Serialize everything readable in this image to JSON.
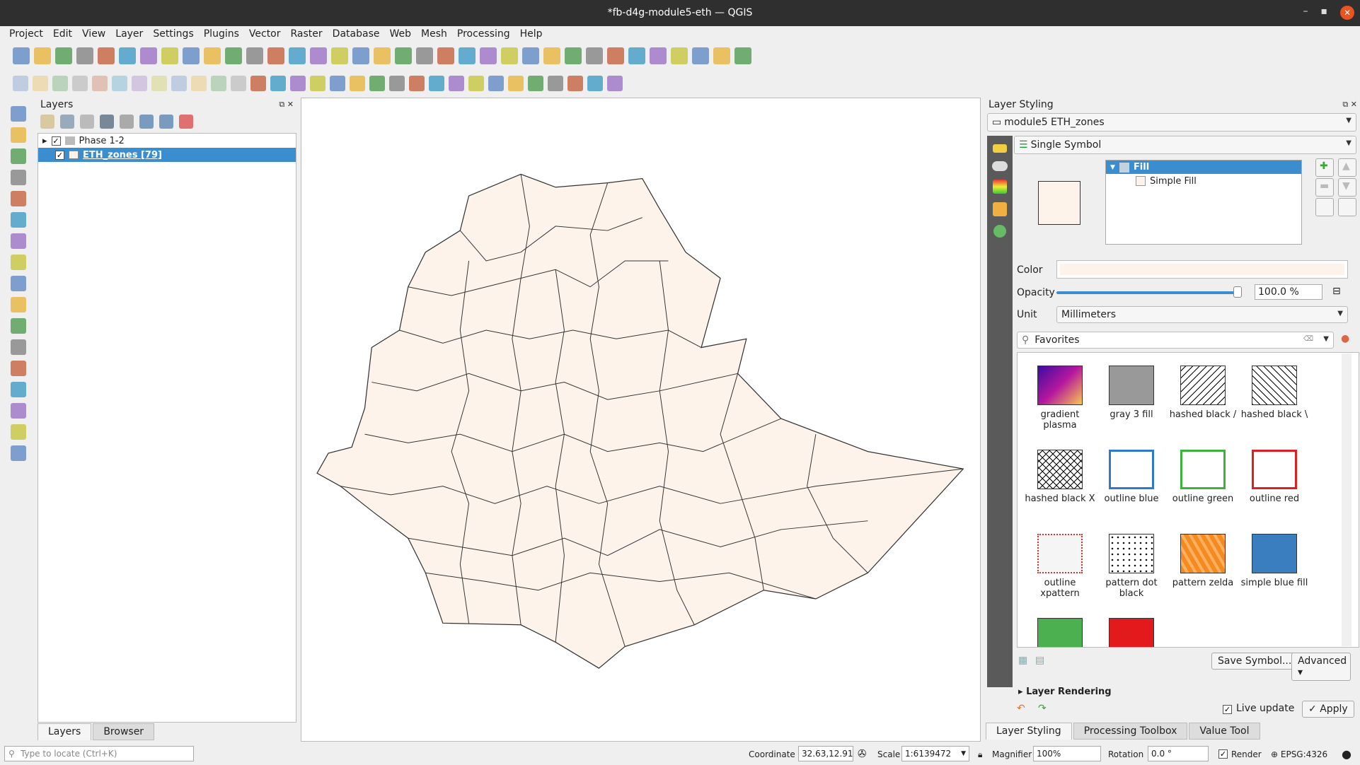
{
  "window": {
    "title": "*fb-d4g-module5-eth — QGIS",
    "controls": [
      "–",
      "▪",
      "✕"
    ]
  },
  "menu": [
    "Project",
    "Edit",
    "View",
    "Layer",
    "Settings",
    "Plugins",
    "Vector",
    "Raster",
    "Database",
    "Web",
    "Mesh",
    "Processing",
    "Help"
  ],
  "toolbar1": [
    "new-project-icon",
    "open-project-icon",
    "save-project-icon",
    "new-print-layout-icon",
    "layout-manager-icon",
    "style-manager-icon",
    "pan-icon",
    "pan-to-selection-icon",
    "zoom-in-icon",
    "zoom-out-icon",
    "zoom-full-icon",
    "zoom-to-selection-icon",
    "zoom-to-layer-icon",
    "zoom-native-icon",
    "zoom-last-icon",
    "zoom-next-icon",
    "new-map-view-icon",
    "new-3d-view-icon",
    "bookmark-icon",
    "show-bookmarks-icon",
    "temporal-controller-icon",
    "refresh-icon",
    "identify-icon",
    "attribute-table-icon",
    "field-calculator-icon",
    "processing-toolbox-icon",
    "statistics-icon",
    "measure-icon",
    "map-tips-icon",
    "annotation-icon",
    "text-annotation-icon",
    "select-features-icon",
    "deselect-icon",
    "select-by-expression-icon",
    "select-location-icon"
  ],
  "toolbar2": [
    "current-edits-icon",
    "toggle-editing-icon",
    "save-edits-icon",
    "add-feature-icon",
    "vertex-tool-icon",
    "modify-attributes-icon",
    "delete-selected-icon",
    "cut-icon",
    "copy-icon",
    "paste-icon",
    "undo-icon",
    "redo-icon",
    "label-icon",
    "diagram-icon",
    "pin-labels-icon",
    "highlight-labels-icon",
    "move-label-icon",
    "rotate-label-icon",
    "change-label-icon",
    "show-hide-labels-icon",
    "label-options-icon",
    "quickmapservices-icon",
    "python-console-icon",
    "globe-icon",
    "metasearch-icon",
    "georeferencer-icon",
    "help-icon",
    "plugin-a-icon",
    "plugin-b-icon",
    "search-plugin-icon",
    "plugin-c-icon"
  ],
  "lefttoolbar": [
    "data-source-manager-icon",
    "add-vector-layer-icon",
    "add-delimited-text-icon",
    "add-spatialite-icon",
    "add-virtual-layer-icon",
    "add-wms-icon",
    "new-shapefile-icon",
    "add-raster-icon",
    "add-mesh-icon",
    "add-gps-icon",
    "add-geopackage-icon",
    "add-postgis-icon",
    "add-wfs-icon",
    "add-wcs-icon",
    "add-xyz-icon",
    "add-vector-tile-icon",
    "add-arcgis-icon"
  ],
  "layers_panel": {
    "title": "Layers",
    "items": [
      {
        "label": "Phase 1-2",
        "checked": "✓",
        "expand": "▸"
      },
      {
        "label": "ETH_zones [79]",
        "checked": "✓"
      }
    ],
    "tabs": [
      "Layers",
      "Browser"
    ]
  },
  "locator": {
    "placeholder": "Type to locate (Ctrl+K)"
  },
  "map": {
    "fill": "#fdf3ea",
    "stroke": "#333333"
  },
  "styling": {
    "title": "Layer Styling",
    "layer": "module5 ETH_zones",
    "renderer": "Single Symbol",
    "tree": {
      "root": "Fill",
      "child": "Simple Fill"
    },
    "color_label": "Color",
    "color": "#fdf3ea",
    "opacity_label": "Opacity",
    "opacity": "100.0 %",
    "opacity_fraction": 1.0,
    "unit_label": "Unit",
    "unit": "Millimeters",
    "search": "Favorites",
    "symbols": [
      {
        "name": "gradient plasma",
        "color": "#d0356a"
      },
      {
        "name": "gray 3 fill",
        "color": "#999999"
      },
      {
        "name": "hashed black /",
        "color": "#ffffff"
      },
      {
        "name": "hashed black \\",
        "color": "#ffffff"
      },
      {
        "name": "hashed black X",
        "color": "#ffffff"
      },
      {
        "name": "outline blue",
        "color": "#2f7ad0"
      },
      {
        "name": "outline green",
        "color": "#3cb43c"
      },
      {
        "name": "outline red",
        "color": "#e02020"
      },
      {
        "name": "outline xpattern",
        "color": "#f5f5f5"
      },
      {
        "name": "pattern dot black",
        "color": "#ffffff"
      },
      {
        "name": "pattern zelda",
        "color": "#f58a1f"
      },
      {
        "name": "simple blue fill",
        "color": "#3a7ec0"
      },
      {
        "name": "",
        "color": "#4caf50"
      },
      {
        "name": "",
        "color": "#e31a1c"
      }
    ],
    "save_symbol": "Save Symbol...",
    "advanced": "Advanced",
    "layer_rendering": "Layer Rendering",
    "live_update": "Live update",
    "apply": "Apply",
    "tabs": [
      "Layer Styling",
      "Processing Toolbox",
      "Value Tool"
    ]
  },
  "status": {
    "coordinate_label": "Coordinate",
    "coordinate": "32.63,12.91",
    "scale_label": "Scale",
    "scale": "1:6139472",
    "magnifier_label": "Magnifier",
    "magnifier": "100%",
    "rotation_label": "Rotation",
    "rotation": "0.0 °",
    "render_label": "Render",
    "crs": "EPSG:4326"
  }
}
